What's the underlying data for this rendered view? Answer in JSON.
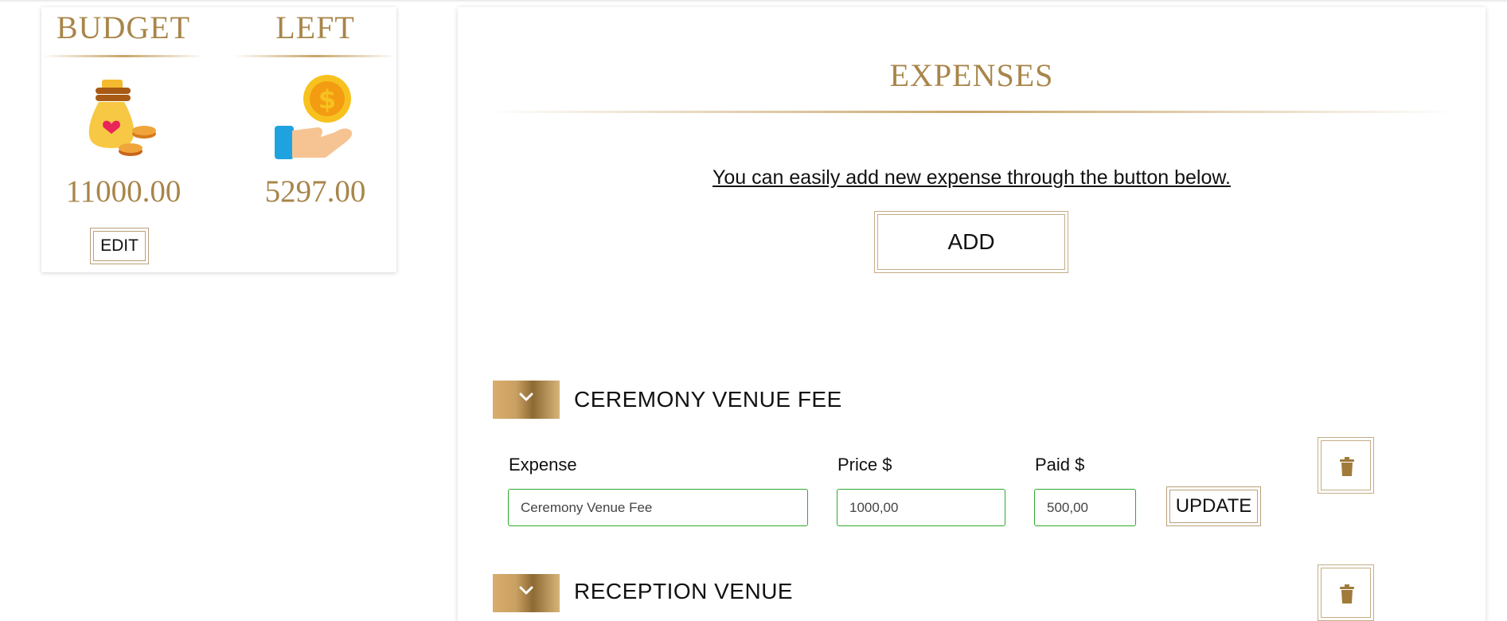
{
  "budget": {
    "budget_label": "BUDGET",
    "left_label": "LEFT",
    "budget_value": "11000.00",
    "left_value": "5297.00",
    "edit_label": "EDIT",
    "budget_icon": "money-bag-icon",
    "left_icon": "coin-hand-icon"
  },
  "expenses": {
    "title": "EXPENSES",
    "hint": "You can easily add new expense through the button below.",
    "add_label": "ADD",
    "items": [
      {
        "name": "CEREMONY VENUE FEE",
        "expanded": true,
        "fields": {
          "expense_label": "Expense",
          "price_label": "Price $",
          "paid_label": "Paid $",
          "expense_value": "Ceremony Venue Fee",
          "price_value": "1000,00",
          "paid_value": "500,00"
        },
        "update_label": "UPDATE"
      },
      {
        "name": "RECEPTION VENUE",
        "expanded": false
      }
    ]
  },
  "colors": {
    "gold": "#a8854a",
    "input_border": "#2eaa2e"
  }
}
